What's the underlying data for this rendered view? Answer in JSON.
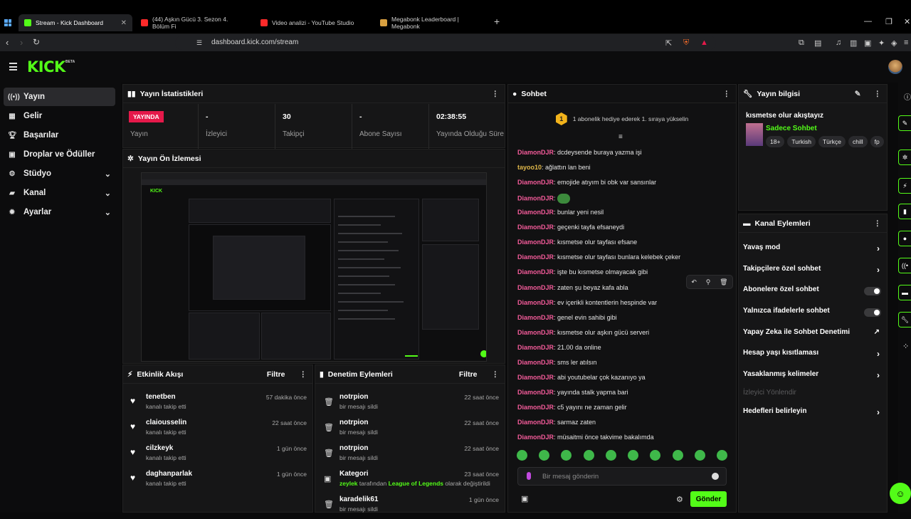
{
  "browser": {
    "tabs": [
      {
        "title": "Stream - Kick Dashboard",
        "color": "#53fc18"
      },
      {
        "title": "(44) Aşkın Gücü 3. Sezon 4. Bölüm Fi",
        "color": "#ff2a2a"
      },
      {
        "title": "Video analizi - YouTube Studio",
        "color": "#ff2a2a"
      },
      {
        "title": "Megabonk Leaderboard | Megabonk",
        "color": "#d8a040"
      }
    ],
    "new_tab": "+",
    "url": "dashboard.kick.com/stream"
  },
  "app": {
    "logo": "KICK",
    "beta": "BETA"
  },
  "sidebar": {
    "items": [
      {
        "label": "Yayın",
        "icon": "broadcast-icon"
      },
      {
        "label": "Gelir",
        "icon": "revenue-icon"
      },
      {
        "label": "Başarılar",
        "icon": "trophy-icon"
      },
      {
        "label": "Droplar ve Ödüller",
        "icon": "gift-icon"
      },
      {
        "label": "Stüdyo",
        "icon": "studio-icon"
      },
      {
        "label": "Kanal",
        "icon": "channel-icon"
      },
      {
        "label": "Ayarlar",
        "icon": "gear-icon"
      }
    ]
  },
  "stats": {
    "title": "Yayın İstatistikleri",
    "badge": "YAYINDA",
    "items": [
      {
        "value": "",
        "label": "Yayın"
      },
      {
        "value": "-",
        "label": "İzleyici"
      },
      {
        "value": "30",
        "label": "Takipçi"
      },
      {
        "value": "-",
        "label": "Abone Sayısı"
      },
      {
        "value": "02:38:55",
        "label": "Yayında Olduğu Süre"
      }
    ]
  },
  "preview": {
    "title": "Yayın Ön İzlemesi",
    "logo": "KICK"
  },
  "events": {
    "title": "Etkinlik Akışı",
    "filter": "Filtre",
    "rows": [
      {
        "name": "tenetben",
        "sub": "kanalı takip etti",
        "time": "57 dakika önce"
      },
      {
        "name": "claiousselin",
        "sub": "kanalı takip etti",
        "time": "22 saat önce"
      },
      {
        "name": "cilzkeyk",
        "sub": "kanalı takip etti",
        "time": "1 gün önce"
      },
      {
        "name": "daghanparlak",
        "sub": "kanalı takip etti",
        "time": "1 gün önce"
      }
    ]
  },
  "moderation": {
    "title": "Denetim Eylemleri",
    "filter": "Filtre",
    "rows": [
      {
        "name": "notrpion",
        "sub": "bir mesajı sildi",
        "time": "22 saat önce"
      },
      {
        "name": "notrpion",
        "sub": "bir mesajı sildi",
        "time": "22 saat önce"
      },
      {
        "name": "notrpion",
        "sub": "bir mesajı sildi",
        "time": "22 saat önce"
      },
      {
        "name": "Kategori",
        "sub_user": "zeylek",
        "sub_mid": "tarafından",
        "sub_game": "League of Legends",
        "sub_end": "olarak değiştirildi",
        "time": "23 saat önce"
      },
      {
        "name": "karadelik61",
        "sub": "bir mesajı sildi",
        "time": "1 gün önce"
      }
    ]
  },
  "chat": {
    "title": "Sohbet",
    "pinned_count": "1",
    "pinned_text": "1 abonelik hediye ederek 1. sıraya yükselin",
    "messages": [
      {
        "user": "DiamonDJR",
        "text": "dcdeysende buraya yazma işi",
        "color": "pink"
      },
      {
        "user": "tayoo10",
        "text": "ağlattın lan beni",
        "color": "gold"
      },
      {
        "user": "DiamonDJR",
        "text": "emojide atıyım bi obk var sansınlar",
        "color": "pink"
      },
      {
        "user": "DiamonDJR",
        "text": "",
        "color": "pink",
        "emote": true
      },
      {
        "user": "DiamonDJR",
        "text": "bunlar yeni nesil",
        "color": "pink"
      },
      {
        "user": "DiamonDJR",
        "text": "geçenki tayfa efsaneydi",
        "color": "pink"
      },
      {
        "user": "DiamonDJR",
        "text": "kısmetse olur tayfası efsane",
        "color": "pink"
      },
      {
        "user": "DiamonDJR",
        "text": "kısmetse olur tayfası bunlara kelebek çeker",
        "color": "pink"
      },
      {
        "user": "DiamonDJR",
        "text": "işte bu kısmetse olmayacak gibi",
        "color": "pink"
      },
      {
        "user": "DiamonDJR",
        "text": "zaten şu beyaz kafa abla",
        "color": "pink"
      },
      {
        "user": "DiamonDJR",
        "text": "ev içerikli kontentlerin hespinde var",
        "color": "pink"
      },
      {
        "user": "DiamonDJR",
        "text": "genel evin sahibi gibi",
        "color": "pink"
      },
      {
        "user": "DiamonDJR",
        "text": "kısmetse olur aşkın gücü serveri",
        "color": "pink"
      },
      {
        "user": "DiamonDJR",
        "text": "21.00 da online",
        "color": "pink"
      },
      {
        "user": "DiamonDJR",
        "text": "sms ler atılsın",
        "color": "pink"
      },
      {
        "user": "DiamonDJR",
        "text": "abi youtubelar çok kazanıyo ya",
        "color": "pink"
      },
      {
        "user": "DiamonDJR",
        "text": "yayında stalk yapma bari",
        "color": "pink"
      },
      {
        "user": "DiamonDJR",
        "text": "c5 yayını ne zaman gelir",
        "color": "pink"
      },
      {
        "user": "DiamonDJR",
        "text": "sarmaz zaten",
        "color": "pink"
      },
      {
        "user": "DiamonDJR",
        "text": "müsaitmi önce takvime bakalımda",
        "color": "pink"
      }
    ],
    "input_placeholder": "Bir mesaj gönderin",
    "send_label": "Gönder"
  },
  "stream_info": {
    "title": "Yayın bilgisi",
    "stream_title": "kısmetse olur akıştayız",
    "category": "Sadece Sohbet",
    "tags": [
      "18+",
      "Turkish",
      "Türkçe",
      "chill",
      "fp"
    ]
  },
  "channel_actions": {
    "title": "Kanal Eylemleri",
    "items": [
      {
        "label": "Yavaş mod",
        "control": "arrow"
      },
      {
        "label": "Takipçilere özel sohbet",
        "control": "arrow"
      },
      {
        "label": "Abonelere özel sohbet",
        "control": "toggle"
      },
      {
        "label": "Yalnızca ifadelerle sohbet",
        "control": "toggle"
      },
      {
        "label": "Yapay Zeka ile Sohbet Denetimi",
        "control": "external"
      },
      {
        "label": "Hesap yaşı kısıtlaması",
        "control": "arrow"
      },
      {
        "label": "Yasaklanmış kelimeler",
        "control": "arrow"
      },
      {
        "label": "İzleyici Yönlendir",
        "control": "none",
        "disabled": true
      },
      {
        "label": "Hedefleri belirleyin",
        "control": "arrow"
      }
    ]
  },
  "colors": {
    "brand": "#53fc18",
    "live": "#e5194a",
    "chat_user": "#f45b9a"
  }
}
